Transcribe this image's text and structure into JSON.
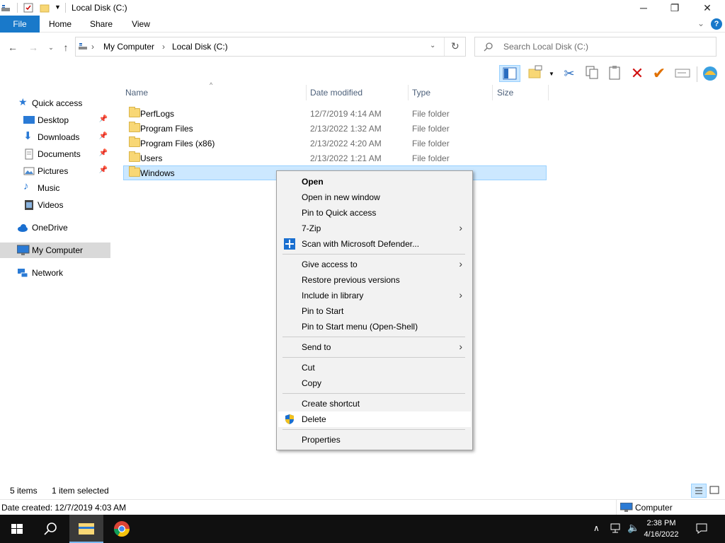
{
  "window": {
    "title": "Local Disk (C:)",
    "controls": {
      "minimize": "─",
      "maximize": "❐",
      "close": "✕"
    }
  },
  "ribbon": {
    "tabs": [
      "File",
      "Home",
      "Share",
      "View"
    ],
    "collapse_glyph": "⌄",
    "help_glyph": "?"
  },
  "address": {
    "crumbs": [
      "My Computer",
      "Local Disk (C:)"
    ],
    "separator": "›",
    "search_placeholder": "Search Local Disk (C:)"
  },
  "nav": {
    "quick_access": "Quick access",
    "items": [
      {
        "label": "Desktop",
        "icon": "desktop-icon",
        "pinned": true
      },
      {
        "label": "Downloads",
        "icon": "downloads-icon",
        "pinned": true
      },
      {
        "label": "Documents",
        "icon": "documents-icon",
        "pinned": true
      },
      {
        "label": "Pictures",
        "icon": "pictures-icon",
        "pinned": true
      },
      {
        "label": "Music",
        "icon": "music-icon",
        "pinned": false
      },
      {
        "label": "Videos",
        "icon": "videos-icon",
        "pinned": false
      }
    ],
    "onedrive": "OneDrive",
    "my_computer": "My Computer",
    "network": "Network"
  },
  "file_list": {
    "columns": {
      "name": "Name",
      "date": "Date modified",
      "type": "Type",
      "size": "Size"
    },
    "rows": [
      {
        "name": "PerfLogs",
        "date": "12/7/2019 4:14 AM",
        "type": "File folder",
        "size": ""
      },
      {
        "name": "Program Files",
        "date": "2/13/2022 1:32 AM",
        "type": "File folder",
        "size": ""
      },
      {
        "name": "Program Files (x86)",
        "date": "2/13/2022 4:20 AM",
        "type": "File folder",
        "size": ""
      },
      {
        "name": "Users",
        "date": "2/13/2022 1:21 AM",
        "type": "File folder",
        "size": ""
      },
      {
        "name": "Windows",
        "date": "",
        "type": "",
        "size": "",
        "selected": true
      }
    ]
  },
  "context_menu": {
    "items": [
      {
        "label": "Open",
        "bold": true
      },
      {
        "label": "Open in new window"
      },
      {
        "label": "Pin to Quick access"
      },
      {
        "label": "7-Zip",
        "submenu": true
      },
      {
        "label": "Scan with Microsoft Defender...",
        "icon": "defender-icon"
      },
      {
        "label": "Give access to",
        "submenu": true
      },
      {
        "label": "Restore previous versions"
      },
      {
        "label": "Include in library",
        "submenu": true
      },
      {
        "label": "Pin to Start"
      },
      {
        "label": "Pin to Start menu (Open-Shell)"
      },
      {
        "label": "Send to",
        "submenu": true
      },
      {
        "label": "Cut"
      },
      {
        "label": "Copy"
      },
      {
        "label": "Create shortcut"
      },
      {
        "label": "Delete",
        "icon": "shield-icon",
        "hover": true
      },
      {
        "label": "Properties"
      }
    ],
    "submenu_arrow": "›"
  },
  "status": {
    "item_count": "5 items",
    "selection": "1 item selected",
    "date_created": "Date created: 12/7/2019 4:03 AM",
    "location": "Computer"
  },
  "taskbar": {
    "time": "2:38 PM",
    "date": "4/16/2022"
  },
  "colors": {
    "accent": "#1979ca",
    "selection_bg": "#cce8ff",
    "folder": "#f8d775",
    "taskbar": "#101010"
  }
}
